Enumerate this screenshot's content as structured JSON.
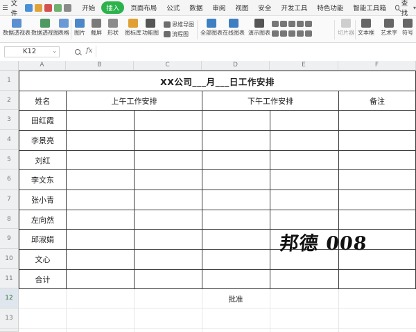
{
  "menubar": {
    "file_label": "文件",
    "tabs": [
      {
        "label": "开始",
        "active": false
      },
      {
        "label": "插入",
        "active": true
      },
      {
        "label": "页面布局",
        "active": false
      },
      {
        "label": "公式",
        "active": false
      },
      {
        "label": "数据",
        "active": false
      },
      {
        "label": "审阅",
        "active": false
      },
      {
        "label": "视图",
        "active": false
      },
      {
        "label": "安全",
        "active": false
      },
      {
        "label": "开发工具",
        "active": false
      },
      {
        "label": "特色功能",
        "active": false
      },
      {
        "label": "智能工具箱",
        "active": false
      }
    ],
    "search_label": "查找",
    "accent_color": "#2bb24c"
  },
  "ribbon": {
    "pivot_table": "数据透视表",
    "pivot_chart": "数据透视图",
    "table": "表格",
    "picture": "图片",
    "screenshot": "截屏",
    "shape": "形状",
    "icon_lib": "图标库",
    "func_chart": "功能图",
    "mind_map": "思维导图",
    "flow_chart": "流程图",
    "all_charts": "全部图表",
    "online_chart": "在线图表",
    "demo_chart": "演示图表",
    "slicer": "切片器",
    "textbox": "文本框",
    "wordart": "艺术字",
    "symbol": "符号"
  },
  "formulabar": {
    "cell_ref": "K12",
    "fx_label": "fx",
    "formula": ""
  },
  "sheet": {
    "columns": [
      "A",
      "B",
      "C",
      "D",
      "E",
      "F"
    ],
    "rows": [
      "1",
      "2",
      "3",
      "4",
      "5",
      "6",
      "7",
      "8",
      "9",
      "10",
      "11",
      "12",
      "13"
    ],
    "title": "XX公司___月___日工作安排",
    "headers": {
      "name": "姓名",
      "morning": "上午工作安排",
      "afternoon": "下午工作安排",
      "note": "备注"
    },
    "names": [
      "田红霞",
      "李景亮",
      "刘红",
      "李文东",
      "张小青",
      "左向然",
      "邱淑娟",
      "文心",
      "合计"
    ],
    "approve_label": "批准",
    "watermark": "邦德 008"
  }
}
